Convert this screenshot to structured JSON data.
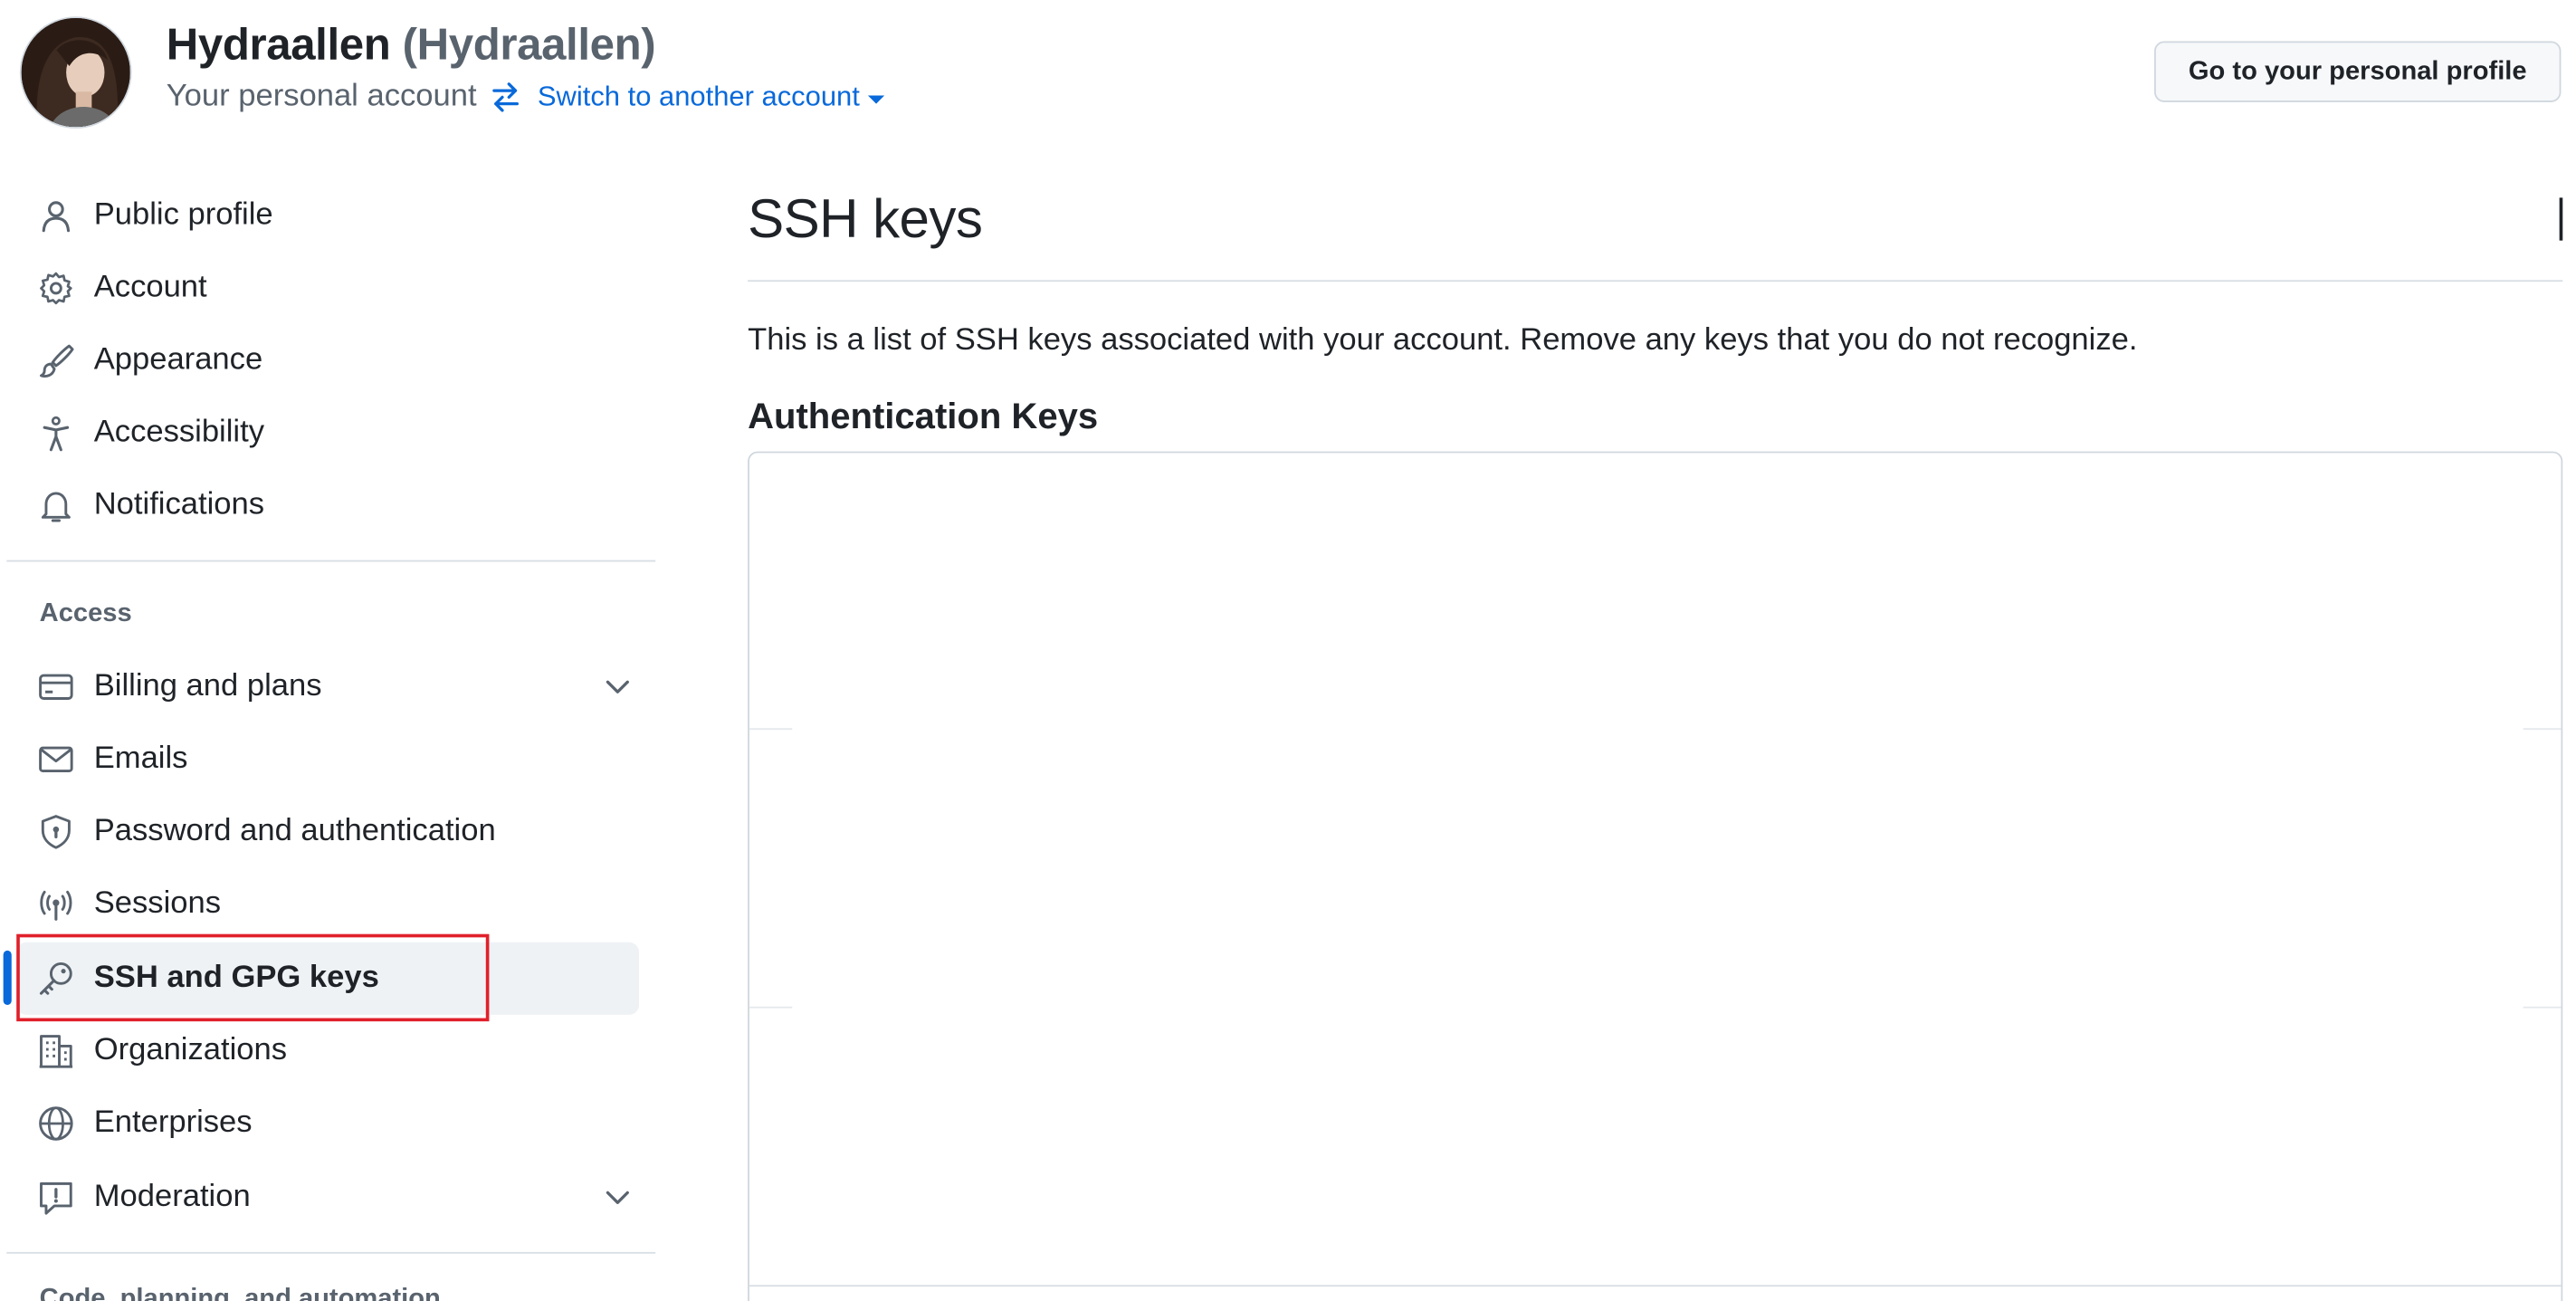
{
  "header": {
    "display_name": "Hydraallen",
    "login": "(Hydraallen)",
    "account_type": "Your personal account",
    "switch_account_label": "Switch to another account",
    "profile_button_label": "Go to your personal profile",
    "avatar_icon": "user-avatar-photo",
    "switch_icon": "arrow-switch-icon"
  },
  "sidebar": {
    "items": [
      {
        "label": "Public profile",
        "icon": "person-icon"
      },
      {
        "label": "Account",
        "icon": "gear-icon"
      },
      {
        "label": "Appearance",
        "icon": "paintbrush-icon"
      },
      {
        "label": "Accessibility",
        "icon": "accessibility-icon"
      },
      {
        "label": "Notifications",
        "icon": "bell-icon"
      }
    ],
    "access_heading": "Access",
    "access_items": [
      {
        "label": "Billing and plans",
        "icon": "credit-card-icon",
        "expandable": true
      },
      {
        "label": "Emails",
        "icon": "mail-icon"
      },
      {
        "label": "Password and authentication",
        "icon": "shield-lock-icon"
      },
      {
        "label": "Sessions",
        "icon": "broadcast-icon"
      },
      {
        "label": "SSH and GPG keys",
        "icon": "key-icon",
        "active": true
      },
      {
        "label": "Organizations",
        "icon": "organization-icon"
      },
      {
        "label": "Enterprises",
        "icon": "globe-icon"
      },
      {
        "label": "Moderation",
        "icon": "report-icon",
        "expandable": true
      }
    ],
    "next_heading": "Code, planning, and automation"
  },
  "main": {
    "title": "SSH keys",
    "description": "This is a list of SSH keys associated with your account. Remove any keys that you do not recognize.",
    "subheading": "Authentication Keys"
  },
  "colors": {
    "accent": "#0969da",
    "text": "#1f2328",
    "muted": "#59636e",
    "highlight_border": "#e0202b",
    "active_bg": "#eff2f5"
  }
}
